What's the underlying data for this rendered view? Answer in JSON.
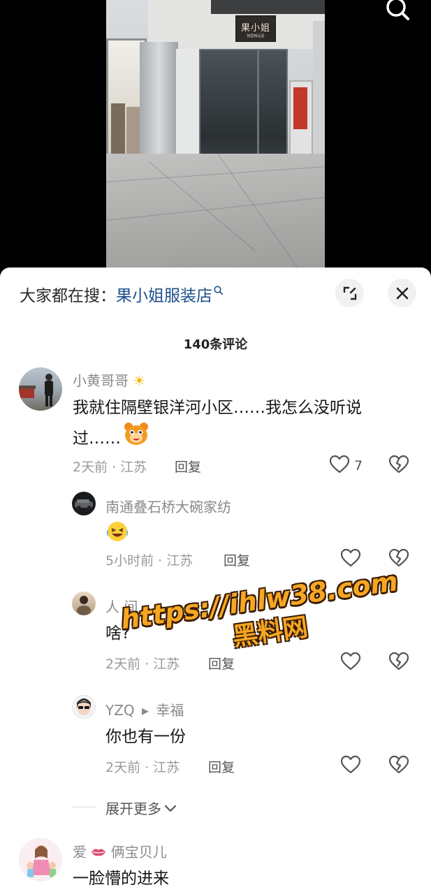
{
  "video": {
    "store_sign": "果小姐",
    "store_sign_sub": "韩国精品屋",
    "search_icon": "search-icon"
  },
  "sheet": {
    "search_prefix": "大家都在搜：",
    "search_term": "果小姐服装店",
    "expand_icon": "expand-icon",
    "close_icon": "close-icon",
    "comment_count": "140条评论"
  },
  "comments": [
    {
      "user": "小黄哥哥",
      "user_suffix_icon": "sun-emoji",
      "text_line1": "我就住隔壁银洋河小区……我怎么没听说",
      "text_line2": "过……",
      "text_emoji": "bear-face-emoji",
      "meta": "2天前 · 江苏",
      "reply": "回复",
      "likes": "7"
    }
  ],
  "replies": [
    {
      "user": "南通叠石桥大碗家纺",
      "text_emoji": "laughing-crying-emoji",
      "meta": "5小时前 · 江苏",
      "reply": "回复"
    },
    {
      "user": "人 间",
      "text": "啥?",
      "meta": "2天前 · 江苏",
      "reply": "回复"
    },
    {
      "user": "YZQ",
      "reply_to_arrow": "▸",
      "reply_to": "幸福",
      "text": "你也有一份",
      "meta": "2天前 · 江苏",
      "reply": "回复"
    }
  ],
  "more_replies": "展开更多",
  "next_comment": {
    "user_prefix": "爱",
    "user_suffix": "俩宝贝儿",
    "text": "一脸懵的进来"
  },
  "watermark": {
    "url": "https://ihlw38.com",
    "sub": "黑料网"
  },
  "colors": {
    "accent_link": "#1c4f8c",
    "watermark": "#f5a623"
  }
}
